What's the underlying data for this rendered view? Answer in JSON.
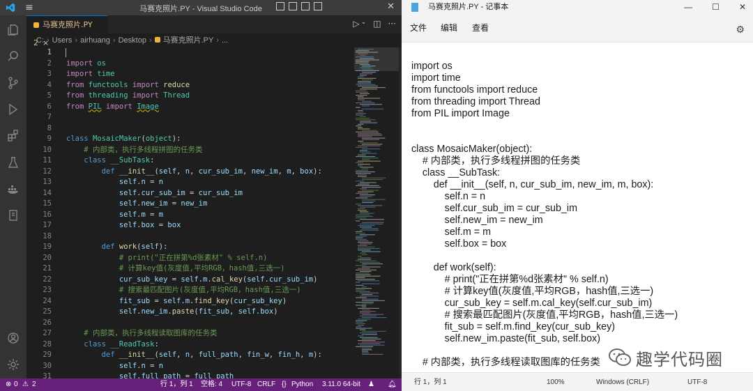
{
  "vscode": {
    "window_title": "马赛克照片.PY - Visual Studio Code",
    "tab": {
      "label": "马赛克照片.PY",
      "problems": "2",
      "close": "×"
    },
    "breadcrumb": [
      "C:",
      "Users",
      "airhuang",
      "Desktop",
      "马赛克照片.PY",
      "..."
    ],
    "code_lines": [
      {
        "n": "1",
        "html": ""
      },
      {
        "n": "2",
        "html": "<span class=\"kw2\">import</span> <span class=\"mod\">os</span>"
      },
      {
        "n": "3",
        "html": "<span class=\"kw2\">import</span> <span class=\"mod\">time</span>"
      },
      {
        "n": "4",
        "html": "<span class=\"kw2\">from</span> <span class=\"mod\">functools</span> <span class=\"kw2\">import</span> <span class=\"fn\">reduce</span>"
      },
      {
        "n": "5",
        "html": "<span class=\"kw2\">from</span> <span class=\"mod\">threading</span> <span class=\"kw2\">import</span> <span class=\"mod\">Thread</span>"
      },
      {
        "n": "6",
        "html": "<span class=\"kw2\">from</span> <span class=\"mod sq\">PIL</span> <span class=\"kw2\">import</span> <span class=\"mod sq\">Image</span>"
      },
      {
        "n": "7",
        "html": ""
      },
      {
        "n": "8",
        "html": ""
      },
      {
        "n": "9",
        "html": "<span class=\"kw\">class</span> <span class=\"mod\">MosaicMaker</span>(<span class=\"mod\">object</span>):"
      },
      {
        "n": "10",
        "html": "    <span class=\"cm\"># 内部类，执行多线程拼图的任务类</span>"
      },
      {
        "n": "11",
        "html": "    <span class=\"kw\">class</span> <span class=\"mod\">__SubTask</span>:"
      },
      {
        "n": "12",
        "html": "        <span class=\"kw\">def</span> <span class=\"fn\">__init__</span>(<span class=\"var\">self</span>, <span class=\"var\">n</span>, <span class=\"var\">cur_sub_im</span>, <span class=\"var\">new_im</span>, <span class=\"var\">m</span>, <span class=\"var\">box</span>):"
      },
      {
        "n": "13",
        "html": "            <span class=\"var\">self</span>.<span class=\"var\">n</span> = <span class=\"var\">n</span>"
      },
      {
        "n": "14",
        "html": "            <span class=\"var\">self</span>.<span class=\"var\">cur_sub_im</span> = <span class=\"var\">cur_sub_im</span>"
      },
      {
        "n": "15",
        "html": "            <span class=\"var\">self</span>.<span class=\"var\">new_im</span> = <span class=\"var\">new_im</span>"
      },
      {
        "n": "16",
        "html": "            <span class=\"var\">self</span>.<span class=\"var\">m</span> = <span class=\"var\">m</span>"
      },
      {
        "n": "17",
        "html": "            <span class=\"var\">self</span>.<span class=\"var\">box</span> = <span class=\"var\">box</span>"
      },
      {
        "n": "18",
        "html": ""
      },
      {
        "n": "19",
        "html": "        <span class=\"kw\">def</span> <span class=\"fn\">work</span>(<span class=\"var\">self</span>):"
      },
      {
        "n": "20",
        "html": "            <span class=\"cm\"># print(\"正在拼第%d张素材\" % self.n)</span>"
      },
      {
        "n": "21",
        "html": "            <span class=\"cm\"># 计算key值(灰度值,平均RGB，hash值,三选一)</span>"
      },
      {
        "n": "22",
        "html": "            <span class=\"var\">cur_sub_key</span> = <span class=\"var\">self</span>.<span class=\"var\">m</span>.<span class=\"fn\">cal_key</span>(<span class=\"var\">self</span>.<span class=\"var\">cur_sub_im</span>)"
      },
      {
        "n": "23",
        "html": "            <span class=\"cm\"># 搜索最匹配图片(灰度值,平均RGB，hash值,三选一)</span>"
      },
      {
        "n": "24",
        "html": "            <span class=\"var\">fit_sub</span> = <span class=\"var\">self</span>.<span class=\"var\">m</span>.<span class=\"fn\">find_key</span>(<span class=\"var\">cur_sub_key</span>)"
      },
      {
        "n": "25",
        "html": "            <span class=\"var\">self</span>.<span class=\"var\">new_im</span>.<span class=\"fn\">paste</span>(<span class=\"var\">fit_sub</span>, <span class=\"var\">self</span>.<span class=\"var\">box</span>)"
      },
      {
        "n": "26",
        "html": ""
      },
      {
        "n": "27",
        "html": "    <span class=\"cm\"># 内部类，执行多线程读取图库的任务类</span>"
      },
      {
        "n": "28",
        "html": "    <span class=\"kw\">class</span> <span class=\"mod\">__ReadTask</span>:"
      },
      {
        "n": "29",
        "html": "        <span class=\"kw\">def</span> <span class=\"fn\">__init__</span>(<span class=\"var\">self</span>, <span class=\"var\">n</span>, <span class=\"var\">full_path</span>, <span class=\"var\">fin_w</span>, <span class=\"var\">fin_h</span>, <span class=\"var\">m</span>):"
      },
      {
        "n": "30",
        "html": "            <span class=\"var\">self</span>.<span class=\"var\">n</span> = <span class=\"var\">n</span>"
      },
      {
        "n": "31",
        "html": "            <span class=\"var\">self</span>.<span class=\"var\">full_path</span> = <span class=\"var\">full_path</span>"
      }
    ],
    "status": {
      "errors": "0",
      "warnings": "2",
      "position": "行 1，列 1",
      "spaces": "空格: 4",
      "encoding": "UTF-8",
      "eol": "CRLF",
      "language": "Python",
      "interpreter": "3.11.0 64-bit"
    },
    "colors": {
      "statusbar": "#68217a",
      "editor_bg": "#1e1e1e",
      "activity_bg": "#333333"
    }
  },
  "notepad": {
    "window_title": "马赛克照片.PY - 记事本",
    "menu": [
      "文件",
      "编辑",
      "查看"
    ],
    "lines": [
      "import os",
      "import time",
      "from functools import reduce",
      "from threading import Thread",
      "from PIL import Image",
      "",
      "",
      "class MosaicMaker(object):",
      "    # 内部类，执行多线程拼图的任务类",
      "    class __SubTask:",
      "        def __init__(self, n, cur_sub_im, new_im, m, box):",
      "            self.n = n",
      "            self.cur_sub_im = cur_sub_im",
      "            self.new_im = new_im",
      "            self.m = m",
      "            self.box = box",
      "",
      "        def work(self):",
      "            # print(\"正在拼第%d张素材\" % self.n)",
      "            # 计算key值(灰度值,平均RGB，hash值,三选一)",
      "            cur_sub_key = self.m.cal_key(self.cur_sub_im)",
      "            # 搜索最匹配图片(灰度值,平均RGB，hash值,三选一)",
      "            fit_sub = self.m.find_key(cur_sub_key)",
      "            self.new_im.paste(fit_sub, self.box)",
      "",
      "    # 内部类，执行多线程读取图库的任务类"
    ],
    "status": {
      "position": "行 1，列 1",
      "zoom": "100%",
      "eol": "Windows (CRLF)",
      "encoding": "UTF-8"
    },
    "watermark": "趣学代码圈"
  }
}
